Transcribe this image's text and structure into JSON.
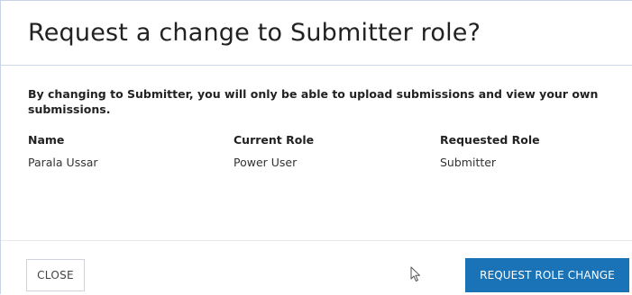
{
  "dialog": {
    "title": "Request a change to Submitter role?",
    "message": "By changing to Submitter, you will only be able to upload submissions and view your own submissions.",
    "columns": [
      {
        "header": "Name",
        "value": "Parala Ussar"
      },
      {
        "header": "Current Role",
        "value": "Power User"
      },
      {
        "header": "Requested Role",
        "value": "Submitter"
      }
    ],
    "buttons": {
      "close_label": "CLOSE",
      "request_label": "REQUEST ROLE CHANGE"
    }
  },
  "colors": {
    "primary": "#1a73b6",
    "header_border": "#cfd8e6",
    "text": "#222222"
  },
  "icons": {
    "cursor": "mouse-pointer-icon"
  }
}
